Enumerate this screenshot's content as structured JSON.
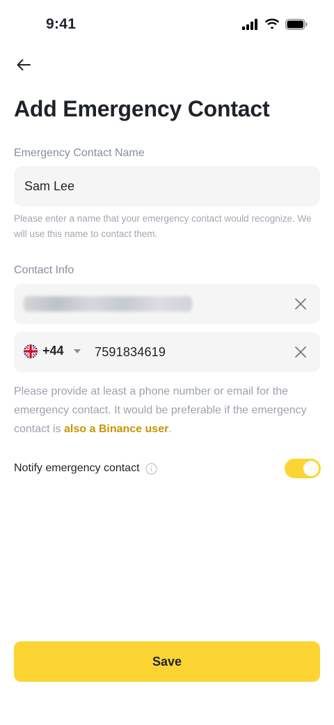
{
  "status_bar": {
    "time": "9:41"
  },
  "page": {
    "title": "Add Emergency Contact"
  },
  "name_section": {
    "label": "Emergency Contact Name",
    "value": "Sam Lee",
    "helper": "Please enter a name that your emergency contact would recognize. We will use this name to contact them."
  },
  "contact_section": {
    "label": "Contact Info",
    "email_value_redacted": true,
    "country_code": "+44",
    "country_flag": "united-kingdom-flag",
    "phone_value": "7591834619",
    "helper_prefix": "Please provide at least a phone number or email for the emergency contact. It would be preferable if the emergency contact is ",
    "helper_link": "also a Binance user",
    "helper_suffix": "."
  },
  "notify": {
    "label": "Notify emergency contact",
    "enabled": true
  },
  "save_label": "Save",
  "colors": {
    "accent": "#fcd535",
    "link": "#c99400",
    "text": "#1e2329",
    "muted": "#848e9c",
    "field_bg": "#f5f5f5"
  }
}
